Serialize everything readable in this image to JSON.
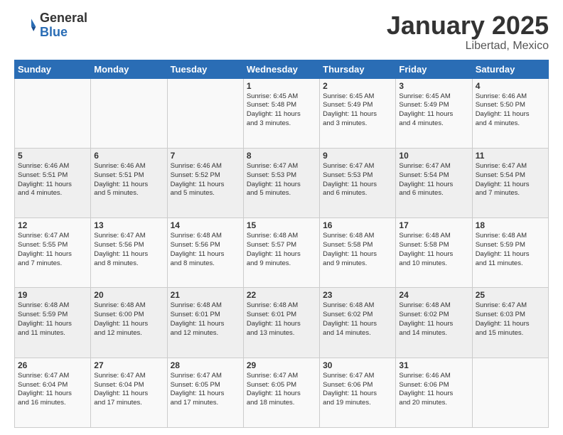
{
  "header": {
    "logo_general": "General",
    "logo_blue": "Blue",
    "month": "January 2025",
    "location": "Libertad, Mexico"
  },
  "weekdays": [
    "Sunday",
    "Monday",
    "Tuesday",
    "Wednesday",
    "Thursday",
    "Friday",
    "Saturday"
  ],
  "weeks": [
    [
      {
        "day": "",
        "info": ""
      },
      {
        "day": "",
        "info": ""
      },
      {
        "day": "",
        "info": ""
      },
      {
        "day": "1",
        "info": "Sunrise: 6:45 AM\nSunset: 5:48 PM\nDaylight: 11 hours\nand 3 minutes."
      },
      {
        "day": "2",
        "info": "Sunrise: 6:45 AM\nSunset: 5:49 PM\nDaylight: 11 hours\nand 3 minutes."
      },
      {
        "day": "3",
        "info": "Sunrise: 6:45 AM\nSunset: 5:49 PM\nDaylight: 11 hours\nand 4 minutes."
      },
      {
        "day": "4",
        "info": "Sunrise: 6:46 AM\nSunset: 5:50 PM\nDaylight: 11 hours\nand 4 minutes."
      }
    ],
    [
      {
        "day": "5",
        "info": "Sunrise: 6:46 AM\nSunset: 5:51 PM\nDaylight: 11 hours\nand 4 minutes."
      },
      {
        "day": "6",
        "info": "Sunrise: 6:46 AM\nSunset: 5:51 PM\nDaylight: 11 hours\nand 5 minutes."
      },
      {
        "day": "7",
        "info": "Sunrise: 6:46 AM\nSunset: 5:52 PM\nDaylight: 11 hours\nand 5 minutes."
      },
      {
        "day": "8",
        "info": "Sunrise: 6:47 AM\nSunset: 5:53 PM\nDaylight: 11 hours\nand 5 minutes."
      },
      {
        "day": "9",
        "info": "Sunrise: 6:47 AM\nSunset: 5:53 PM\nDaylight: 11 hours\nand 6 minutes."
      },
      {
        "day": "10",
        "info": "Sunrise: 6:47 AM\nSunset: 5:54 PM\nDaylight: 11 hours\nand 6 minutes."
      },
      {
        "day": "11",
        "info": "Sunrise: 6:47 AM\nSunset: 5:54 PM\nDaylight: 11 hours\nand 7 minutes."
      }
    ],
    [
      {
        "day": "12",
        "info": "Sunrise: 6:47 AM\nSunset: 5:55 PM\nDaylight: 11 hours\nand 7 minutes."
      },
      {
        "day": "13",
        "info": "Sunrise: 6:47 AM\nSunset: 5:56 PM\nDaylight: 11 hours\nand 8 minutes."
      },
      {
        "day": "14",
        "info": "Sunrise: 6:48 AM\nSunset: 5:56 PM\nDaylight: 11 hours\nand 8 minutes."
      },
      {
        "day": "15",
        "info": "Sunrise: 6:48 AM\nSunset: 5:57 PM\nDaylight: 11 hours\nand 9 minutes."
      },
      {
        "day": "16",
        "info": "Sunrise: 6:48 AM\nSunset: 5:58 PM\nDaylight: 11 hours\nand 9 minutes."
      },
      {
        "day": "17",
        "info": "Sunrise: 6:48 AM\nSunset: 5:58 PM\nDaylight: 11 hours\nand 10 minutes."
      },
      {
        "day": "18",
        "info": "Sunrise: 6:48 AM\nSunset: 5:59 PM\nDaylight: 11 hours\nand 11 minutes."
      }
    ],
    [
      {
        "day": "19",
        "info": "Sunrise: 6:48 AM\nSunset: 5:59 PM\nDaylight: 11 hours\nand 11 minutes."
      },
      {
        "day": "20",
        "info": "Sunrise: 6:48 AM\nSunset: 6:00 PM\nDaylight: 11 hours\nand 12 minutes."
      },
      {
        "day": "21",
        "info": "Sunrise: 6:48 AM\nSunset: 6:01 PM\nDaylight: 11 hours\nand 12 minutes."
      },
      {
        "day": "22",
        "info": "Sunrise: 6:48 AM\nSunset: 6:01 PM\nDaylight: 11 hours\nand 13 minutes."
      },
      {
        "day": "23",
        "info": "Sunrise: 6:48 AM\nSunset: 6:02 PM\nDaylight: 11 hours\nand 14 minutes."
      },
      {
        "day": "24",
        "info": "Sunrise: 6:48 AM\nSunset: 6:02 PM\nDaylight: 11 hours\nand 14 minutes."
      },
      {
        "day": "25",
        "info": "Sunrise: 6:47 AM\nSunset: 6:03 PM\nDaylight: 11 hours\nand 15 minutes."
      }
    ],
    [
      {
        "day": "26",
        "info": "Sunrise: 6:47 AM\nSunset: 6:04 PM\nDaylight: 11 hours\nand 16 minutes."
      },
      {
        "day": "27",
        "info": "Sunrise: 6:47 AM\nSunset: 6:04 PM\nDaylight: 11 hours\nand 17 minutes."
      },
      {
        "day": "28",
        "info": "Sunrise: 6:47 AM\nSunset: 6:05 PM\nDaylight: 11 hours\nand 17 minutes."
      },
      {
        "day": "29",
        "info": "Sunrise: 6:47 AM\nSunset: 6:05 PM\nDaylight: 11 hours\nand 18 minutes."
      },
      {
        "day": "30",
        "info": "Sunrise: 6:47 AM\nSunset: 6:06 PM\nDaylight: 11 hours\nand 19 minutes."
      },
      {
        "day": "31",
        "info": "Sunrise: 6:46 AM\nSunset: 6:06 PM\nDaylight: 11 hours\nand 20 minutes."
      },
      {
        "day": "",
        "info": ""
      }
    ]
  ]
}
